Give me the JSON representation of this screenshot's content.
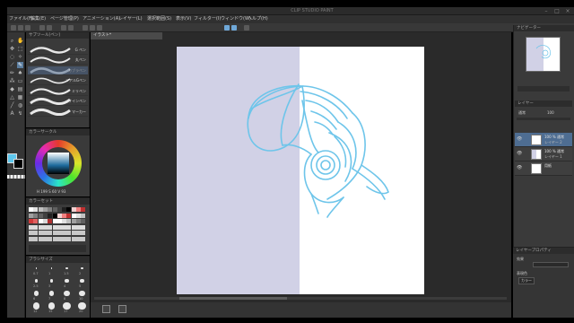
{
  "window": {
    "title": "CLIP STUDIO PAINT",
    "controls": [
      "–",
      "□",
      "×"
    ]
  },
  "menu": {
    "items": [
      "ファイル(F)",
      "編集(E)",
      "ページ管理(P)",
      "アニメーション(A)",
      "レイヤー(L)",
      "選択範囲(S)",
      "表示(V)",
      "フィルター(I)",
      "ウィンドウ(W)",
      "ヘルプ(H)"
    ]
  },
  "toolbar": {
    "tools": [
      "zoom-icon",
      "hand-icon",
      "move-icon",
      "select-icon",
      "lasso-icon",
      "wand-icon",
      "eyedropper-icon",
      "pen-icon",
      "pencil-icon",
      "brush-icon",
      "airbrush-icon",
      "eraser-icon",
      "fill-icon",
      "gradient-icon",
      "text-icon",
      "frame-icon",
      "ruler-icon",
      "figure-icon",
      "balloon-icon",
      "correct-icon"
    ]
  },
  "subtool": {
    "tab_label": "サブツール[ペン]",
    "brushes": [
      {
        "label": "G ペン"
      },
      {
        "label": "丸ペン"
      },
      {
        "label": "カブラペン"
      },
      {
        "label": "リアルGペン"
      },
      {
        "label": "ミリペン"
      },
      {
        "label": "サインペン"
      },
      {
        "label": "マーカー"
      }
    ]
  },
  "colorpanel": {
    "tab_label": "カラーサークル",
    "foreground": "#5ec8ee",
    "background": "#000000",
    "values": "H 199  S 60  V 93"
  },
  "swatchpanel": {
    "tab_label": "カラーセット"
  },
  "sizepanel": {
    "tab_label": "ブラシサイズ",
    "sizes": [
      "0.7",
      "1",
      "1.5",
      "2",
      "2.5",
      "3",
      "4",
      "5",
      "6",
      "7",
      "8",
      "10",
      "12",
      "15",
      "17",
      "20"
    ]
  },
  "canvas": {
    "tab_label": "イラスト*",
    "paper_color": "#ffffff",
    "left_fill_color": "#d1d1e6",
    "sketch_color": "#6ec5ea"
  },
  "navigator": {
    "tab_label": "ナビゲーター"
  },
  "layers": {
    "tab_label": "レイヤー",
    "blend_mode": "通常",
    "opacity": "100",
    "rows": [
      {
        "name": "100 % 通常",
        "sub": "レイヤー 2"
      },
      {
        "name": "100 % 通常",
        "sub": "レイヤー 1"
      },
      {
        "name": "用紙",
        "sub": ""
      }
    ]
  },
  "properties": {
    "tab_label": "レイヤープロパティ",
    "effect_label": "効果",
    "color_label": "表現色",
    "color_value": "カラー"
  }
}
